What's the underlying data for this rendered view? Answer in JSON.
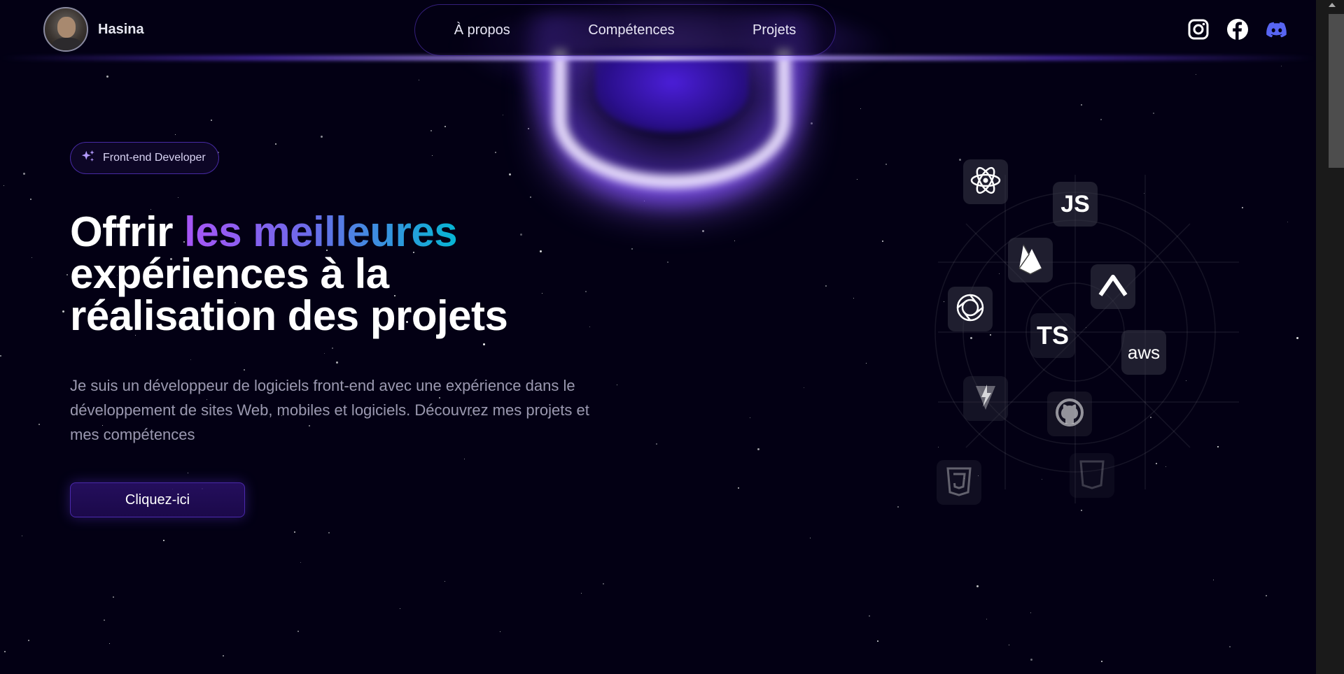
{
  "header": {
    "brand": {
      "name": "Hasina",
      "avatar_icon": "profile-photo"
    },
    "nav": [
      {
        "label": "À propos"
      },
      {
        "label": "Compétences"
      },
      {
        "label": "Projets"
      }
    ],
    "socials": [
      {
        "icon": "instagram-icon",
        "color": "#ffffff"
      },
      {
        "icon": "facebook-icon",
        "color": "#ffffff"
      },
      {
        "icon": "discord-icon",
        "color": "#5865f2"
      }
    ]
  },
  "hero": {
    "badge": {
      "icon": "sparkles-icon",
      "label": "Front-end Developer"
    },
    "headline": {
      "part1": "Offrir ",
      "highlight": "les meilleures",
      "part2": " expériences à la réalisation des projets"
    },
    "description": "Je suis un développeur de logiciels front-end avec une expérience dans le développement de sites Web, mobiles et logiciels. Découvrez mes projets et mes compétences",
    "cta_label": "Cliquez-ici"
  },
  "skills": [
    {
      "icon": "react-icon"
    },
    {
      "icon": "javascript-icon",
      "label": "JS"
    },
    {
      "icon": "firebase-icon"
    },
    {
      "icon": "openai-icon"
    },
    {
      "icon": "vercel-icon"
    },
    {
      "icon": "typescript-icon",
      "label": "TS"
    },
    {
      "icon": "aws-icon",
      "label": "aws"
    },
    {
      "icon": "vite-icon"
    },
    {
      "icon": "github-icon"
    },
    {
      "icon": "css3-icon"
    },
    {
      "icon": "html5-icon"
    }
  ],
  "colors": {
    "background": "#030014",
    "accent": "#7042f8",
    "gradient_start": "#a855f7",
    "gradient_end": "#06b6d4"
  }
}
